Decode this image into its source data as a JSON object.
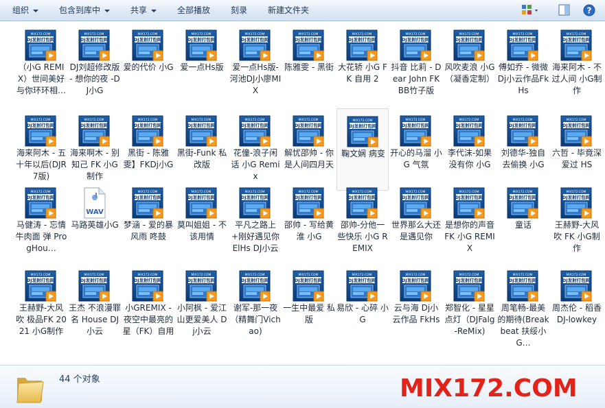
{
  "toolbar": {
    "organize": "组织",
    "include_in_library": "包含到库中",
    "share": "共享",
    "play_all": "全部播放",
    "burn": "刻录",
    "new_folder": "新建文件夹"
  },
  "thumbnail": {
    "site": "MIX172.COM",
    "banner": "DJ发射打包网"
  },
  "files": [
    {
      "name": "（小G REMIX）世间美好与你环环相…",
      "type": "mp3"
    },
    {
      "name": "DJ刘超修改版 - 想你的夜 -DJ小G",
      "type": "mp3"
    },
    {
      "name": "爱的代价 小G",
      "type": "mp3"
    },
    {
      "name": "爱一点Hs版",
      "type": "mp3"
    },
    {
      "name": "爱一点Hs版-河池DJ小廖MIX",
      "type": "mp3"
    },
    {
      "name": "陈雅雯 - 黑街",
      "type": "mp3"
    },
    {
      "name": "大花轿 小G FK 自用 2",
      "type": "mp3"
    },
    {
      "name": "抖音 比莉 - Dear John FKBB竹子版",
      "type": "mp3"
    },
    {
      "name": "风吹麦浪 小G（凝香定制）",
      "type": "mp3"
    },
    {
      "name": "傅如乔 - 微微 Dj小云作品FkHs",
      "type": "mp3"
    },
    {
      "name": "海来阿木 - 不过人间 小G制作",
      "type": "mp3"
    },
    {
      "name": "海来阿木 - 五十年以后(DJR7版)",
      "type": "mp3"
    },
    {
      "name": "海来啊木 - 别知己 FK 小G制作",
      "type": "mp3"
    },
    {
      "name": "黑街 - 陈雅雯】FKDj小G",
      "type": "mp3"
    },
    {
      "name": "黑街-Funk 私改版",
      "type": "mp3"
    },
    {
      "name": "花僮-浪子闲话 小G Remix",
      "type": "mp3"
    },
    {
      "name": "解忧邵帅 - 你是人间四月天",
      "type": "mp3"
    },
    {
      "name": "鞠文娴 病变",
      "type": "mp3"
    },
    {
      "name": "开心的马溜 小G 气氛",
      "type": "mp3"
    },
    {
      "name": "李代沫-如果没有你 小G",
      "type": "mp3"
    },
    {
      "name": "刘德华-独自去偷换 小G",
      "type": "mp3"
    },
    {
      "name": "六哲 - 毕竟深爱过 HS",
      "type": "mp3"
    },
    {
      "name": "马健涛 - 忘情牛肉面 弹 ProgHou…",
      "type": "mp3"
    },
    {
      "name": "马路英雄小G",
      "type": "wav"
    },
    {
      "name": "梦涵 - 爱的暴风雨 咚鼓",
      "type": "mp3"
    },
    {
      "name": "莫叫姐姐 - 不该用情",
      "type": "mp3"
    },
    {
      "name": "平凡之路上+刚好遇见你 ElHs DJ小云",
      "type": "mp3"
    },
    {
      "name": "邵帅 - 写给黄淮 小G",
      "type": "mp3"
    },
    {
      "name": "邵帅-分他一些快乐 小G REMIX",
      "type": "mp3"
    },
    {
      "name": "世界那么大还是遇见你",
      "type": "mp3"
    },
    {
      "name": "是想你的声音 FK 小G REMIX",
      "type": "mp3"
    },
    {
      "name": "童话",
      "type": "mp3"
    },
    {
      "name": "王赫野-大风吹 FK 小G制作",
      "type": "mp3"
    },
    {
      "name": "王赫野-大风吹 极品FK 2021 小G制作",
      "type": "mp3"
    },
    {
      "name": "王杰 不浪漫罪名 House DJ小云",
      "type": "mp3"
    },
    {
      "name": "小GREMIX - 夜空中最亮的星（FK）自用",
      "type": "mp3"
    },
    {
      "name": "小阿枫 - 爱江山更爱美人 Dj小云",
      "type": "mp3"
    },
    {
      "name": "谢军-那一夜（精舞门Vichao)",
      "type": "mp3"
    },
    {
      "name": "一生中最爱 私版",
      "type": "mp3"
    },
    {
      "name": "易欣 - 心碎 小G",
      "type": "mp3"
    },
    {
      "name": "云与海 Dj小云作品 FkHs",
      "type": "mp3"
    },
    {
      "name": "郑智化 - 星星点灯（DJFalg-ReMix)",
      "type": "mp3"
    },
    {
      "name": "周笔畅-最美的期待(Breakbeat 扶绥小G…",
      "type": "mp3"
    },
    {
      "name": "周杰伦 - 稻香 DJ-lowkey",
      "type": "mp3"
    }
  ],
  "selected_index": 17,
  "status": {
    "count": "44 个对象"
  },
  "watermark": "MIX172.COM"
}
